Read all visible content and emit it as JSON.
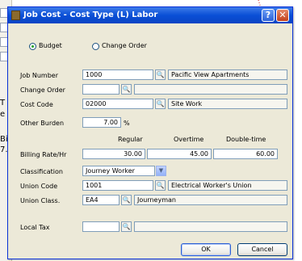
{
  "background": {
    "left_fragments": [
      "T",
      "e",
      "Bi",
      "7."
    ]
  },
  "dialog": {
    "title": "Job Cost - Cost Type (L) Labor",
    "help_label": "?",
    "close_label": "✕",
    "radios": [
      {
        "label": "Budget",
        "selected": true
      },
      {
        "label": "Change Order",
        "selected": false
      }
    ],
    "job_number": {
      "label": "Job Number",
      "value": "1000",
      "description": "Pacific View Apartments"
    },
    "change_order": {
      "label": "Change Order",
      "value": "",
      "description": ""
    },
    "cost_code": {
      "label": "Cost Code",
      "value": "02000",
      "description": "Site Work"
    },
    "other_burden": {
      "label": "Other Burden",
      "value": "7.00",
      "unit": "%"
    },
    "rate_headers": [
      "Regular",
      "Overtime",
      "Double-time"
    ],
    "billing_rate": {
      "label": "Billing Rate/Hr",
      "values": [
        "30.00",
        "45.00",
        "60.00"
      ]
    },
    "classification": {
      "label": "Classification",
      "value": "Journey Worker"
    },
    "union_code": {
      "label": "Union Code",
      "value": "1001",
      "description": "Electrical Worker's Union"
    },
    "union_class": {
      "label": "Union Class.",
      "value": "EA4",
      "description": "Journeyman"
    },
    "local_tax": {
      "label": "Local Tax",
      "value": "",
      "description": ""
    },
    "buttons": {
      "ok": "OK",
      "cancel": "Cancel"
    },
    "lookup_glyph": "🔍",
    "dropdown_glyph": "▼"
  }
}
